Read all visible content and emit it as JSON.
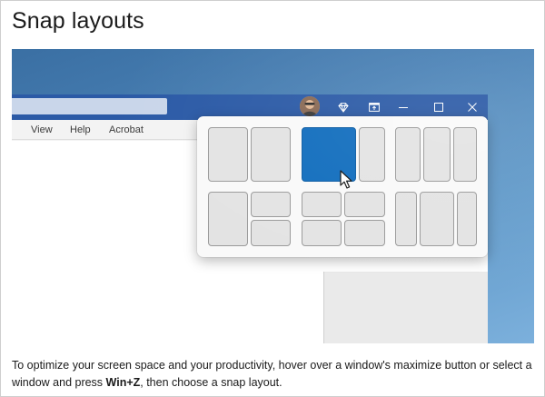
{
  "heading": "Snap layouts",
  "app_window": {
    "menu": [
      "View",
      "Help",
      "Acrobat"
    ],
    "controls": [
      "premium-diamond-icon",
      "pin-window-icon",
      "minimize-icon",
      "maximize-icon",
      "close-icon"
    ]
  },
  "snap_layouts": {
    "groups": 6,
    "highlighted_zone": "layout-2-left-large"
  },
  "caption": {
    "part1": "To optimize your screen space and your productivity, hover over a window's maximize button or select a window and press ",
    "shortcut": "Win+Z",
    "part2": ", then choose a snap layout."
  },
  "colors": {
    "titlebar": "#2b5aa6",
    "accent": "#0f6cbd",
    "desktop": "#4b82b6"
  }
}
